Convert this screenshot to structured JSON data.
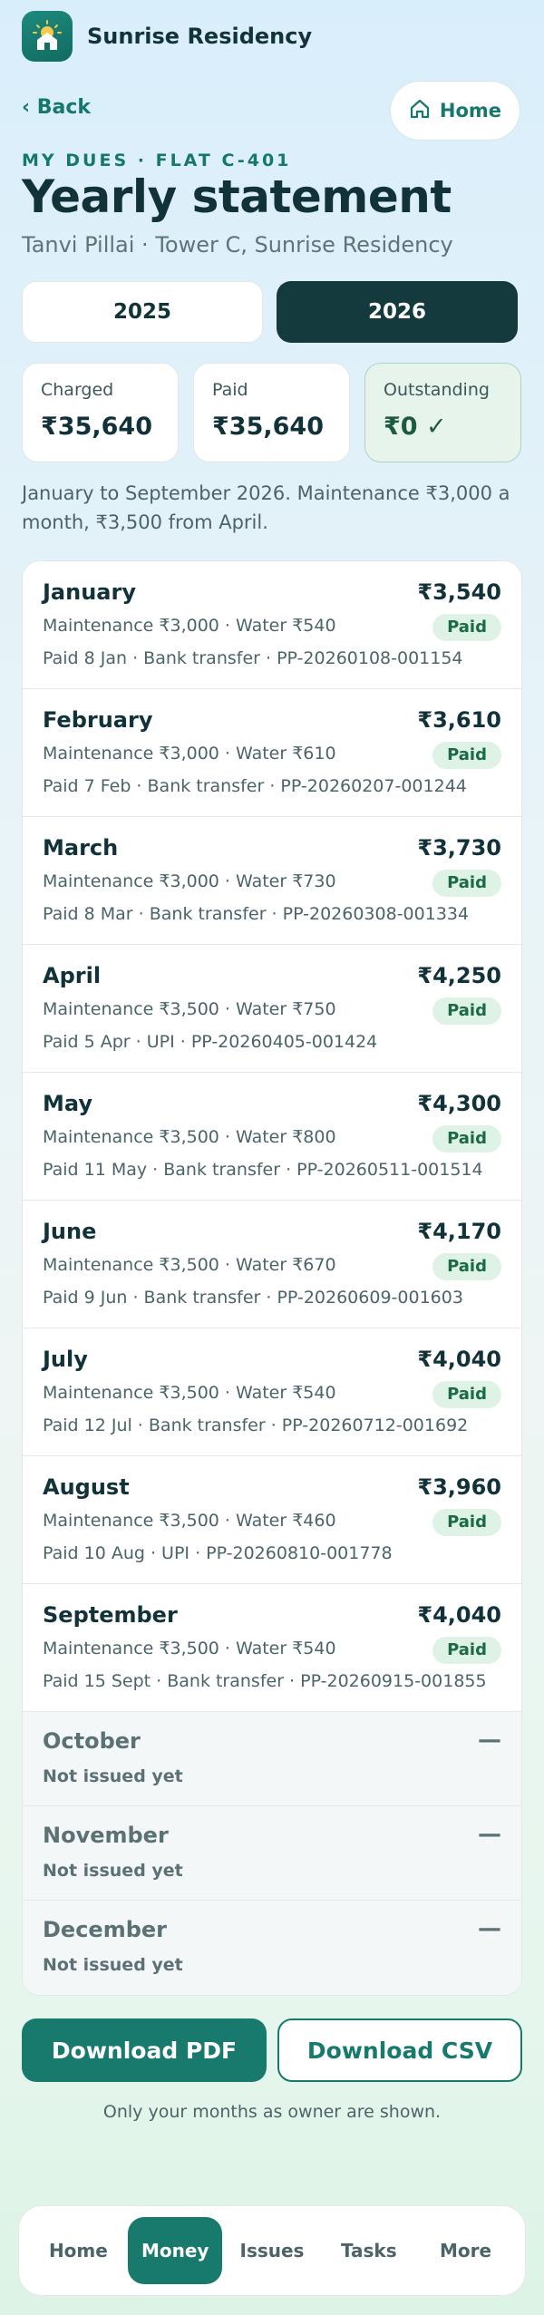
{
  "app": {
    "title": "Sunrise Residency",
    "logo_icon": "house-sunrise-icon"
  },
  "nav": {
    "back_label": "‹ Back",
    "home_label": "Home"
  },
  "header": {
    "eyebrow": "MY DUES · FLAT C-401",
    "title": "Yearly statement",
    "subtitle": "Tanvi Pillai · Tower C, Sunrise Residency"
  },
  "years": {
    "options": [
      "2025",
      "2026"
    ],
    "selected": "2026"
  },
  "summary": {
    "charged_label": "Charged",
    "charged_value": "₹35,640",
    "paid_label": "Paid",
    "paid_value": "₹35,640",
    "outstanding_label": "Outstanding",
    "outstanding_value": "₹0 ✓"
  },
  "note": "January to September 2026. Maintenance ₹3,000 a month, ₹3,500 from April.",
  "months": [
    {
      "name": "January",
      "amount": "₹3,540",
      "breakdown": "Maintenance ₹3,000 · Water ₹540",
      "badge": "Paid",
      "ref": "Paid 8 Jan · Bank transfer · PP-20260108-001154"
    },
    {
      "name": "February",
      "amount": "₹3,610",
      "breakdown": "Maintenance ₹3,000 · Water ₹610",
      "badge": "Paid",
      "ref": "Paid 7 Feb · Bank transfer · PP-20260207-001244"
    },
    {
      "name": "March",
      "amount": "₹3,730",
      "breakdown": "Maintenance ₹3,000 · Water ₹730",
      "badge": "Paid",
      "ref": "Paid 8 Mar · Bank transfer · PP-20260308-001334"
    },
    {
      "name": "April",
      "amount": "₹4,250",
      "breakdown": "Maintenance ₹3,500 · Water ₹750",
      "badge": "Paid",
      "ref": "Paid 5 Apr · UPI · PP-20260405-001424"
    },
    {
      "name": "May",
      "amount": "₹4,300",
      "breakdown": "Maintenance ₹3,500 · Water ₹800",
      "badge": "Paid",
      "ref": "Paid 11 May · Bank transfer · PP-20260511-001514"
    },
    {
      "name": "June",
      "amount": "₹4,170",
      "breakdown": "Maintenance ₹3,500 · Water ₹670",
      "badge": "Paid",
      "ref": "Paid 9 Jun · Bank transfer · PP-20260609-001603"
    },
    {
      "name": "July",
      "amount": "₹4,040",
      "breakdown": "Maintenance ₹3,500 · Water ₹540",
      "badge": "Paid",
      "ref": "Paid 12 Jul · Bank transfer · PP-20260712-001692"
    },
    {
      "name": "August",
      "amount": "₹3,960",
      "breakdown": "Maintenance ₹3,500 · Water ₹460",
      "badge": "Paid",
      "ref": "Paid 10 Aug · UPI · PP-20260810-001778"
    },
    {
      "name": "September",
      "amount": "₹4,040",
      "breakdown": "Maintenance ₹3,500 · Water ₹540",
      "badge": "Paid",
      "ref": "Paid 15 Sept · Bank transfer · PP-20260915-001855"
    }
  ],
  "pending_months": [
    {
      "name": "October",
      "dash": "—",
      "status": "Not issued yet"
    },
    {
      "name": "November",
      "dash": "—",
      "status": "Not issued yet"
    },
    {
      "name": "December",
      "dash": "—",
      "status": "Not issued yet"
    }
  ],
  "downloads": {
    "pdf_label": "Download PDF",
    "csv_label": "Download CSV"
  },
  "footer_note": "Only your months as owner are shown.",
  "bottom_nav": [
    {
      "label": "Home",
      "active": false
    },
    {
      "label": "Money",
      "active": true
    },
    {
      "label": "Issues",
      "active": false
    },
    {
      "label": "Tasks",
      "active": false
    },
    {
      "label": "More",
      "active": false
    }
  ],
  "colors": {
    "accent": "#177a6d",
    "dark": "#143a3d",
    "paid_badge_bg": "#dff2e6",
    "paid_badge_text": "#1a6a45"
  }
}
